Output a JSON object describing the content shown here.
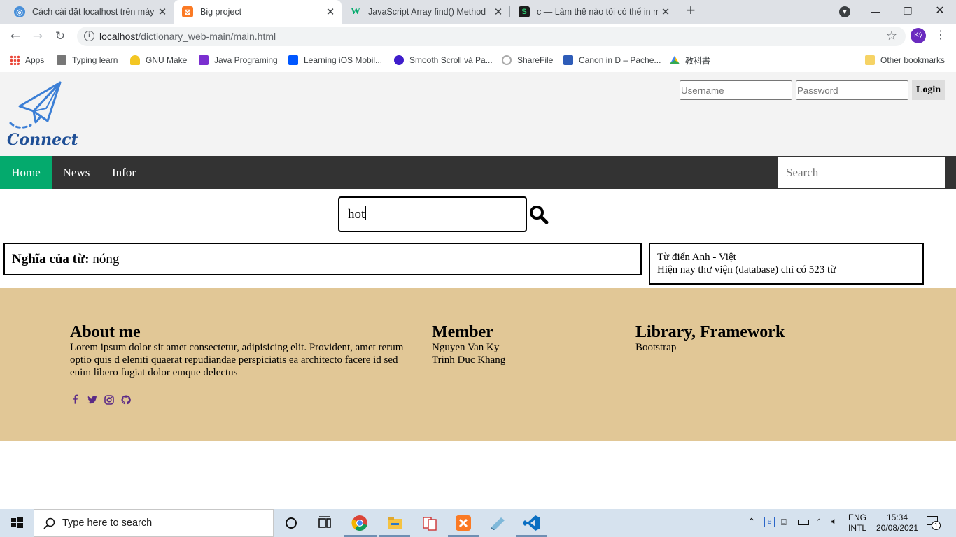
{
  "browser": {
    "tabs": [
      {
        "title": "Cách cài đặt localhost trên máy tí",
        "active": false,
        "favicon": "globe-icon"
      },
      {
        "title": "Big project",
        "active": true,
        "favicon": "xampp-icon"
      },
      {
        "title": "JavaScript Array find() Method",
        "active": false,
        "favicon": "w3schools-icon"
      },
      {
        "title": "c — Làm thế nào tôi có thể in mộ",
        "active": false,
        "favicon": "stackoverflow-icon"
      }
    ],
    "url_host": "localhost",
    "url_path": "/dictionary_web-main/main.html",
    "profile_initials": "Kỳ",
    "bookmarks": [
      {
        "label": "Apps",
        "icon": "apps-grid-icon"
      },
      {
        "label": "Typing learn",
        "icon": "page-icon"
      },
      {
        "label": "GNU Make",
        "icon": "gnu-icon"
      },
      {
        "label": "Java Programing",
        "icon": "java-icon"
      },
      {
        "label": "Learning iOS Mobil...",
        "icon": "behance-icon"
      },
      {
        "label": "Smooth Scroll và Pa...",
        "icon": "n-icon"
      },
      {
        "label": "ShareFile",
        "icon": "sharefile-icon"
      },
      {
        "label": "Canon in D – Pache...",
        "icon": "music-icon"
      },
      {
        "label": "教科書",
        "icon": "drive-icon"
      }
    ],
    "other_bookmarks": "Other bookmarks"
  },
  "site": {
    "logo_text": "Connect",
    "login": {
      "username_placeholder": "Username",
      "password_placeholder": "Password",
      "button": "Login"
    },
    "nav": {
      "items": [
        "Home",
        "News",
        "Infor"
      ],
      "active": "Home",
      "search_placeholder": "Search"
    },
    "lookup": {
      "query": "hot"
    },
    "result": {
      "label": "Nghĩa của từ:",
      "meaning": "nóng"
    },
    "info": {
      "line1": "Từ điển Anh - Việt",
      "line2": "Hiện nay thư viện (database) chỉ có 523 từ"
    },
    "footer": {
      "about_title": "About me",
      "about_text": "Lorem ipsum dolor sit amet consectetur, adipisicing elit. Provident, amet rerum optio quis d eleniti quaerat repudiandae perspiciatis ea architecto facere id sed enim libero fugiat dolor emque delectus",
      "member_title": "Member",
      "members": [
        "Nguyen Van Ky",
        "Trinh Duc Khang"
      ],
      "library_title": "Library, Framework",
      "libraries": [
        "Bootstrap"
      ],
      "social_icons": [
        "facebook-icon",
        "twitter-icon",
        "instagram-icon",
        "github-icon"
      ],
      "social_color": "#5b2a86"
    },
    "colors": {
      "header_bg": "#f3f3f3",
      "nav_bg": "#333333",
      "nav_active": "#04aa6d",
      "footer_bg": "#e1c796"
    }
  },
  "taskbar": {
    "search_placeholder": "Type here to search",
    "language_1": "ENG",
    "language_2": "INTL",
    "time": "15:34",
    "date": "20/08/2021",
    "notification_count": "1"
  }
}
